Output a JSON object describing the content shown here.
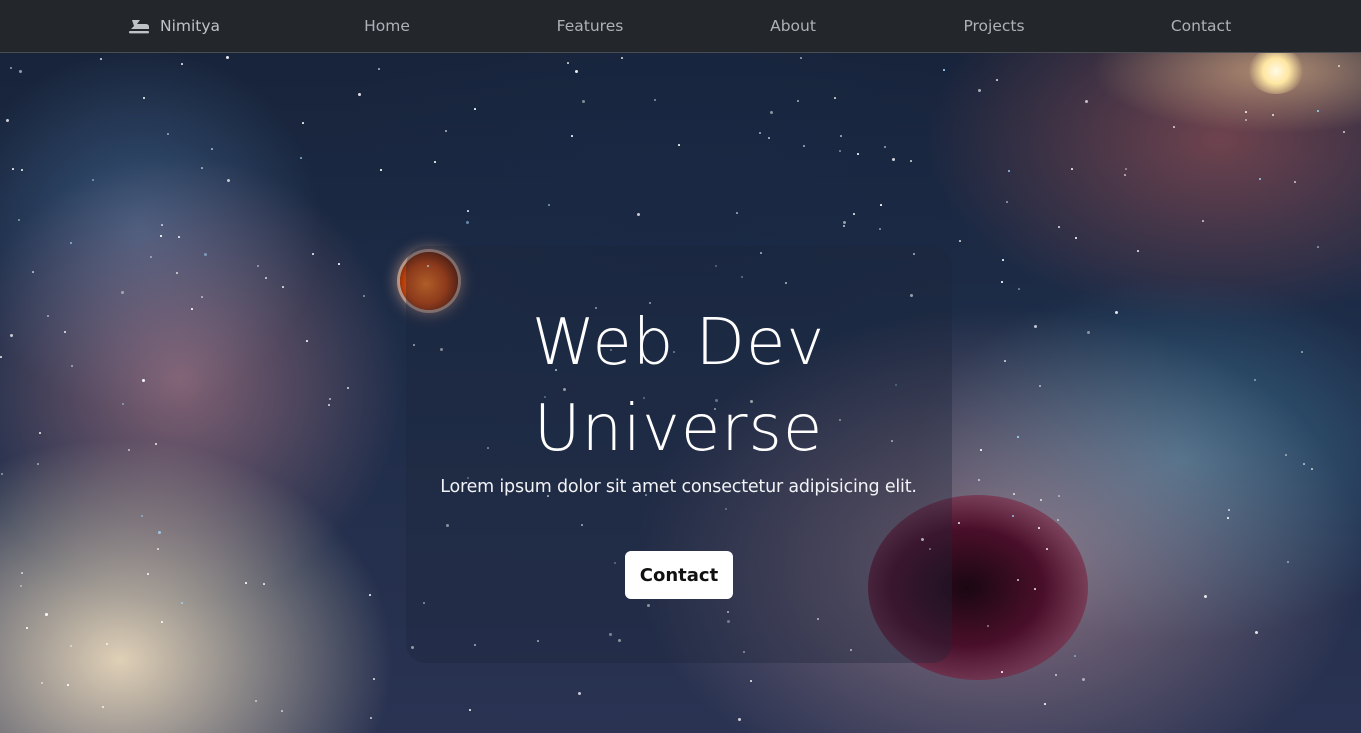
{
  "nav": {
    "brand": "Nimitya",
    "brand_icon": "spaceship-icon",
    "links": [
      "Home",
      "Features",
      "About",
      "Projects",
      "Contact"
    ]
  },
  "hero": {
    "title_line1": "Web Dev",
    "title_line2": "Universe",
    "subtitle": "Lorem ipsum dolor sit amet consectetur adipisicing elit.",
    "button_label": "Contact"
  },
  "colors": {
    "navbar_bg": "#23262b",
    "nav_text": "#aeb2b8",
    "hero_text": "#ffffff",
    "button_bg": "#ffffff",
    "button_text": "#111111"
  }
}
